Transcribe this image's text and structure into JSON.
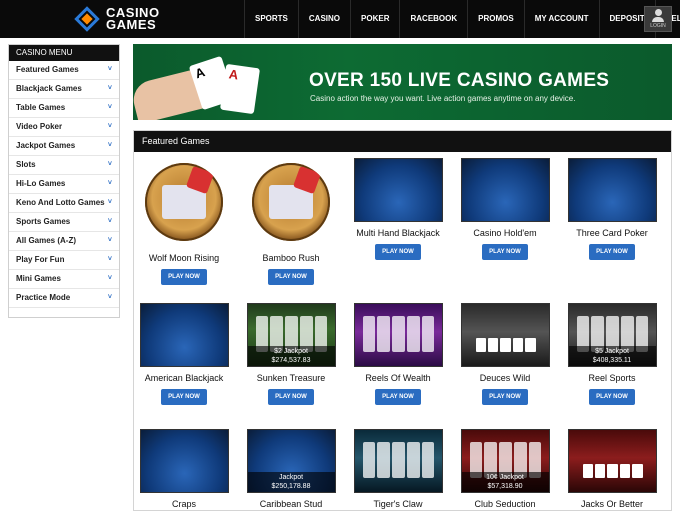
{
  "logo": {
    "line1": "CASINO",
    "line2": "GAMES"
  },
  "nav": [
    "SPORTS",
    "CASINO",
    "POKER",
    "RACEBOOK",
    "PROMOS",
    "MY ACCOUNT",
    "DEPOSIT",
    "HELP"
  ],
  "login": {
    "label": "LOGIN",
    "icon": "user-icon"
  },
  "sidebar": {
    "title": "CASINO MENU",
    "items": [
      {
        "label": "Featured Games"
      },
      {
        "label": "Blackjack Games"
      },
      {
        "label": "Table Games"
      },
      {
        "label": "Video Poker"
      },
      {
        "label": "Jackpot Games"
      },
      {
        "label": "Slots"
      },
      {
        "label": "Hi-Lo Games"
      },
      {
        "label": "Keno And Lotto Games"
      },
      {
        "label": "Sports Games"
      },
      {
        "label": "All Games (A-Z)"
      },
      {
        "label": "Play For Fun"
      },
      {
        "label": "Mini Games"
      },
      {
        "label": "Practice Mode"
      }
    ],
    "chevron": "˅"
  },
  "banner": {
    "title": "OVER 150 LIVE CASINO GAMES",
    "subtitle": "Casino action the way you want. Live action games anytime on any device.",
    "card1": "A",
    "card2": "A"
  },
  "featured": {
    "title": "Featured Games",
    "play_label": "PLAY NOW",
    "games": [
      {
        "name": "Wolf Moon Rising",
        "style": "round"
      },
      {
        "name": "Bamboo Rush",
        "style": "round"
      },
      {
        "name": "Multi Hand Blackjack",
        "style": "t-blue"
      },
      {
        "name": "Casino Hold'em",
        "style": "t-blue"
      },
      {
        "name": "Three Card Poker",
        "style": "t-blue"
      },
      {
        "name": "American Blackjack",
        "style": "t-blue"
      },
      {
        "name": "Sunken Treasure",
        "style": "t-slot-green",
        "jackpot1": "$2 Jackpot",
        "jackpot2": "$274,537.83"
      },
      {
        "name": "Reels Of Wealth",
        "style": "t-slot-purple"
      },
      {
        "name": "Deuces Wild",
        "style": "t-slot-dark",
        "cards": true
      },
      {
        "name": "Reel Sports",
        "style": "t-slot-dark",
        "jackpot1": "$5 Jackpot",
        "jackpot2": "$408,335.11"
      },
      {
        "name": "Craps",
        "style": "t-blue"
      },
      {
        "name": "Caribbean Stud",
        "style": "t-blue",
        "jackpot1": "Jackpot",
        "jackpot2": "$250,178.88"
      },
      {
        "name": "Tiger's Claw",
        "style": "t-slot-teal"
      },
      {
        "name": "Club Seduction",
        "style": "t-slot-red",
        "jackpot1": "10¢ Jackpot",
        "jackpot2": "$57,318.90"
      },
      {
        "name": "Jacks Or Better",
        "style": "t-slot-red",
        "cards": true
      }
    ]
  }
}
